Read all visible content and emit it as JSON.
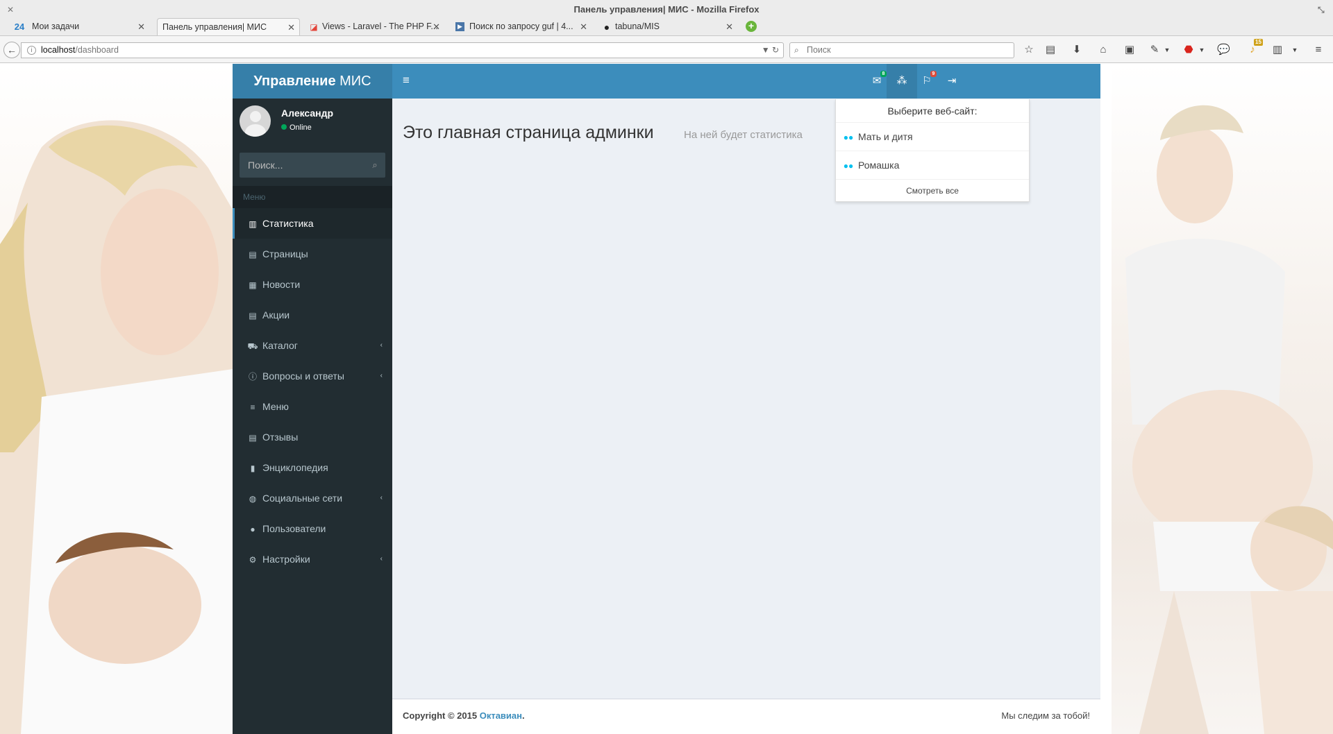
{
  "browser": {
    "window_title": "Панель управления| МИС - Mozilla Firefox",
    "tabs": [
      {
        "label": "Мои задачи",
        "icon": "24"
      },
      {
        "label": "Панель управления| МИС",
        "icon": ""
      },
      {
        "label": "Views - Laravel - The PHP F...",
        "icon": "laravel-icon"
      },
      {
        "label": "Поиск по запросу guf | 4...",
        "icon": "video-icon"
      },
      {
        "label": "tabuna/MIS",
        "icon": "github-icon"
      }
    ],
    "url_host": "localhost",
    "url_path": "/dashboard",
    "search_placeholder": "Поиск",
    "addon_badge": "15"
  },
  "admin": {
    "logo_bold": "Управление",
    "logo_light": " МИС",
    "badges": {
      "mail": "8",
      "flag": "9"
    },
    "user": {
      "name": "Александр",
      "status": "Online"
    },
    "search_placeholder": "Поиск...",
    "menu_header": "Меню",
    "menu": [
      {
        "label": "Статистика",
        "icon": "bar-chart-icon"
      },
      {
        "label": "Страницы",
        "icon": "file-icon"
      },
      {
        "label": "Новости",
        "icon": "newspaper-icon"
      },
      {
        "label": "Акции",
        "icon": "file-icon"
      },
      {
        "label": "Каталог",
        "icon": "cart-icon"
      },
      {
        "label": "Вопросы и ответы",
        "icon": "info-icon"
      },
      {
        "label": "Меню",
        "icon": "list-icon"
      },
      {
        "label": "Отзывы",
        "icon": "file-icon"
      },
      {
        "label": "Энциклопедия",
        "icon": "book-icon"
      },
      {
        "label": "Социальные сети",
        "icon": "globe-icon"
      },
      {
        "label": "Пользователи",
        "icon": "user-icon"
      },
      {
        "label": "Настройки",
        "icon": "gear-icon"
      }
    ],
    "page_title": "Это главная страница админки",
    "page_subtitle": "На ней будет статистика",
    "dropdown": {
      "header": "Выберите веб-сайт:",
      "items": [
        "Мать и дитя",
        "Ромашка"
      ],
      "footer": "Смотреть все"
    },
    "footer": {
      "copyright": "Copyright © 2015 ",
      "company": "Октавиан",
      "slogan": "Мы следим за тобой!"
    },
    "colors": {
      "header": "#3c8dbc",
      "logo": "#367fa9",
      "sidebar": "#222d32",
      "content": "#ecf0f5"
    }
  }
}
